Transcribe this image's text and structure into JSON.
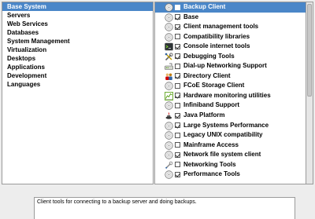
{
  "categories": [
    {
      "label": "Base System",
      "selected": true
    },
    {
      "label": "Servers"
    },
    {
      "label": "Web Services"
    },
    {
      "label": "Databases"
    },
    {
      "label": "System Management"
    },
    {
      "label": "Virtualization"
    },
    {
      "label": "Desktops"
    },
    {
      "label": "Applications"
    },
    {
      "label": "Development"
    },
    {
      "label": "Languages"
    }
  ],
  "packages": [
    {
      "label": "Backup Client",
      "checked": false,
      "selected": true,
      "icon": "backup-icon"
    },
    {
      "label": "Base",
      "checked": true,
      "icon": "package-icon"
    },
    {
      "label": "Client management tools",
      "checked": true,
      "icon": "package-icon"
    },
    {
      "label": "Compatibility libraries",
      "checked": false,
      "icon": "package-icon"
    },
    {
      "label": "Console internet tools",
      "checked": true,
      "icon": "terminal-icon"
    },
    {
      "label": "Debugging Tools",
      "checked": true,
      "icon": "debug-tools-icon"
    },
    {
      "label": "Dial-up Networking Support",
      "checked": false,
      "icon": "modem-icon"
    },
    {
      "label": "Directory Client",
      "checked": true,
      "icon": "users-icon"
    },
    {
      "label": "FCoE Storage Client",
      "checked": false,
      "icon": "package-icon"
    },
    {
      "label": "Hardware monitoring utilities",
      "checked": true,
      "icon": "monitor-chart-icon"
    },
    {
      "label": "Infiniband Support",
      "checked": false,
      "icon": "package-icon"
    },
    {
      "label": "Java Platform",
      "checked": true,
      "icon": "java-icon"
    },
    {
      "label": "Large Systems Performance",
      "checked": true,
      "icon": "package-icon"
    },
    {
      "label": "Legacy UNIX compatibility",
      "checked": false,
      "icon": "package-icon"
    },
    {
      "label": "Mainframe Access",
      "checked": false,
      "icon": "package-icon"
    },
    {
      "label": "Network file system client",
      "checked": true,
      "icon": "package-icon"
    },
    {
      "label": "Networking Tools",
      "checked": false,
      "icon": "network-tools-icon"
    },
    {
      "label": "Performance Tools",
      "checked": true,
      "icon": "package-icon"
    }
  ],
  "description": "Client tools for connecting to a backup server and doing backups.",
  "colors": {
    "selection": "#4a86c8",
    "panel_border": "#9a9a9a",
    "window_bg": "#ededed"
  }
}
